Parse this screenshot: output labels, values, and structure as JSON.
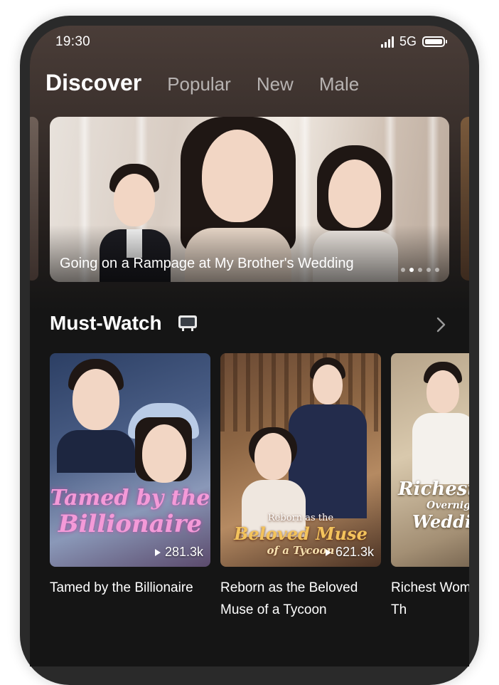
{
  "status_bar": {
    "time": "19:30",
    "network": "5G",
    "icons": [
      "signal-icon",
      "battery-icon"
    ]
  },
  "tabs": [
    {
      "label": "Discover",
      "active": true
    },
    {
      "label": "Popular",
      "active": false
    },
    {
      "label": "New",
      "active": false
    },
    {
      "label": "Male",
      "active": false
    }
  ],
  "banner": {
    "title": "Going on a Rampage at My Brother's Wedding",
    "dots": 5,
    "active_dot": 2
  },
  "section": {
    "title": "Must-Watch",
    "title_icon": "tv-icon",
    "more_icon": "chevron-right-icon"
  },
  "cards": [
    {
      "poster_lines": [
        "Tamed by the",
        "Billionaire"
      ],
      "views": "281.3k",
      "name": "Tamed by the Billionaire"
    },
    {
      "poster_lines": [
        "Reborn as the",
        "Beloved Muse",
        "of a Tycoon"
      ],
      "views": "621.3k",
      "name": "Reborn as the Beloved Muse of a Tycoon"
    },
    {
      "poster_lines": [
        "Richest",
        "Overnight",
        "Wedding"
      ],
      "views": "",
      "name": "Richest Woman Overnight Th"
    }
  ],
  "colors": {
    "background": "#151515",
    "text": "#ffffff",
    "tab_inactive": "#a29d9a",
    "poster_title_pink": "#f49ad8",
    "poster_title_gold": "#f3c35c"
  }
}
